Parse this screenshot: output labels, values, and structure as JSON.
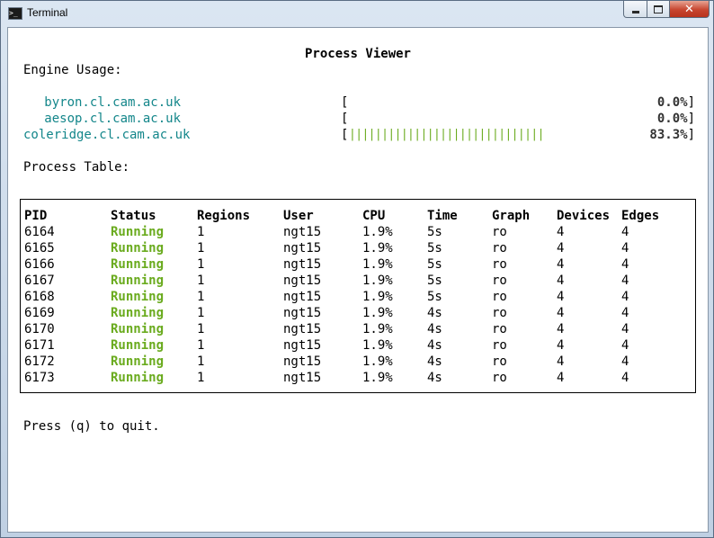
{
  "window": {
    "title": "Terminal",
    "close_symbol": "✕"
  },
  "terminal": {
    "heading": "Process Viewer",
    "engine_label": "Engine Usage:",
    "engines": [
      {
        "host": "byron.cl.cam.ac.uk",
        "bar": "",
        "percent": "0.0%",
        "usage": 0.0
      },
      {
        "host": "aesop.cl.cam.ac.uk",
        "bar": "",
        "percent": "0.0%",
        "usage": 0.0
      },
      {
        "host": "coleridge.cl.cam.ac.uk",
        "bar": "||||||||||||||||||||||||||||||",
        "percent": "83.3%",
        "usage": 83.3
      }
    ],
    "bracket_open": "[",
    "bracket_close": "]",
    "table_label": "Process Table:",
    "columns": [
      "PID",
      "Status",
      "Regions",
      "User",
      "CPU",
      "Time",
      "Graph",
      "Devices",
      "Edges"
    ],
    "rows": [
      [
        "6164",
        "Running",
        "1",
        "ngt15",
        "1.9%",
        "5s",
        "ro",
        "4",
        "4"
      ],
      [
        "6165",
        "Running",
        "1",
        "ngt15",
        "1.9%",
        "5s",
        "ro",
        "4",
        "4"
      ],
      [
        "6166",
        "Running",
        "1",
        "ngt15",
        "1.9%",
        "5s",
        "ro",
        "4",
        "4"
      ],
      [
        "6167",
        "Running",
        "1",
        "ngt15",
        "1.9%",
        "5s",
        "ro",
        "4",
        "4"
      ],
      [
        "6168",
        "Running",
        "1",
        "ngt15",
        "1.9%",
        "5s",
        "ro",
        "4",
        "4"
      ],
      [
        "6169",
        "Running",
        "1",
        "ngt15",
        "1.9%",
        "4s",
        "ro",
        "4",
        "4"
      ],
      [
        "6170",
        "Running",
        "1",
        "ngt15",
        "1.9%",
        "4s",
        "ro",
        "4",
        "4"
      ],
      [
        "6171",
        "Running",
        "1",
        "ngt15",
        "1.9%",
        "4s",
        "ro",
        "4",
        "4"
      ],
      [
        "6172",
        "Running",
        "1",
        "ngt15",
        "1.9%",
        "4s",
        "ro",
        "4",
        "4"
      ],
      [
        "6173",
        "Running",
        "1",
        "ngt15",
        "1.9%",
        "4s",
        "ro",
        "4",
        "4"
      ]
    ],
    "footer": "Press (q) to quit."
  },
  "colors": {
    "host": "#13868a",
    "running": "#6aab1e",
    "bar": "#6aab1e"
  }
}
